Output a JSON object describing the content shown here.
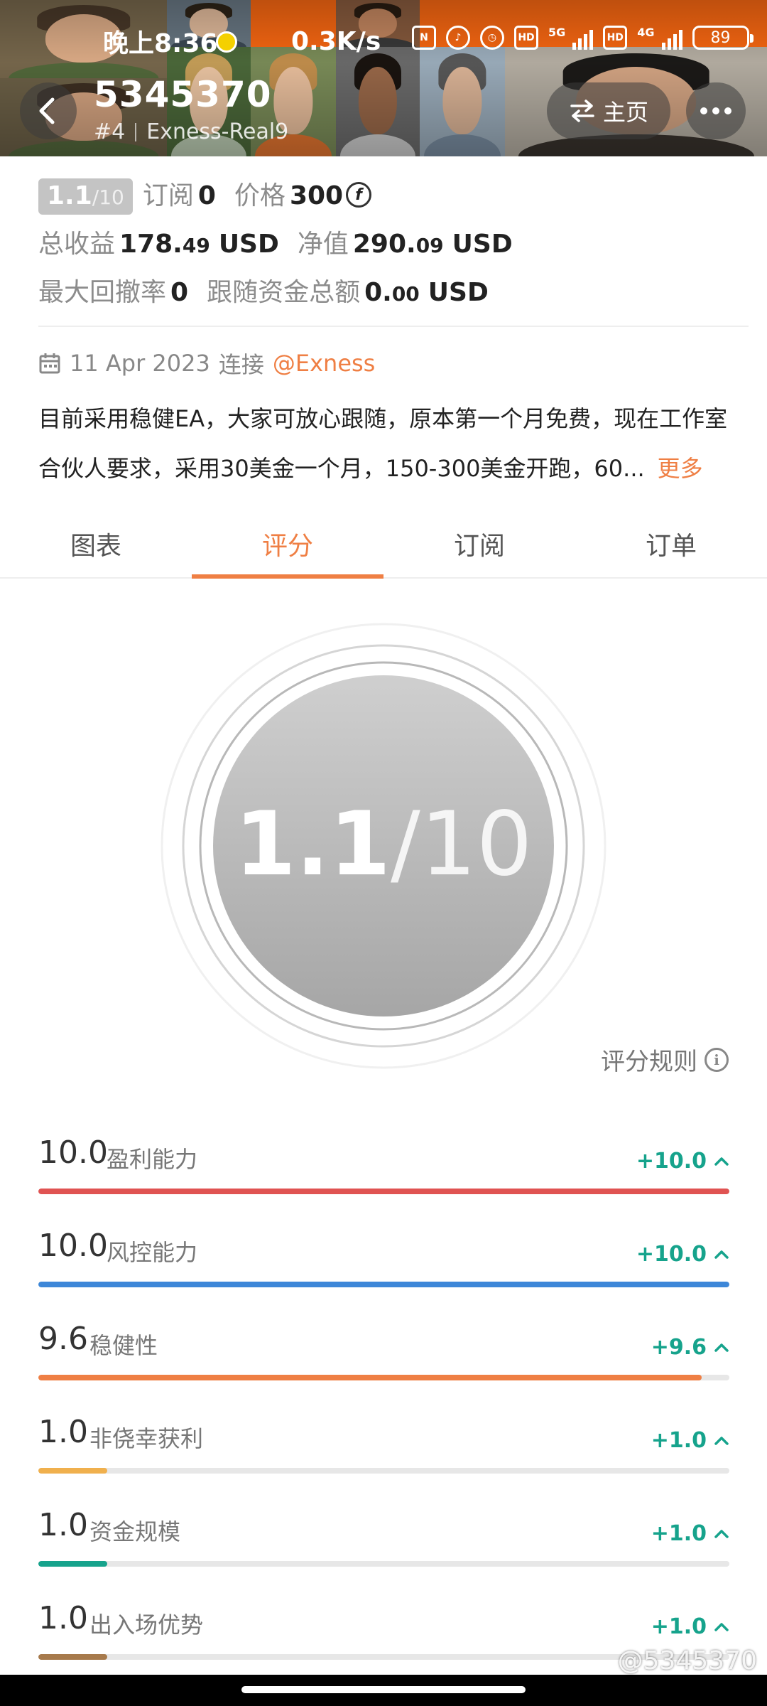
{
  "status_bar": {
    "time": "晚上8:36",
    "net_speed": "0.3K/s",
    "network_1": "5G",
    "network_2": "4G",
    "hd": "HD",
    "battery": "89"
  },
  "header": {
    "title": "5345370",
    "rank": "#4",
    "account": "Exness-Real9",
    "home_label": "主页"
  },
  "stats": {
    "score_value": "1.1",
    "score_max": "/10",
    "subscribe_label": "订阅",
    "subscribe_value": "0",
    "price_label": "价格",
    "price_value": "300",
    "coin_glyph": "f",
    "total_profit_label": "总收益",
    "total_profit_int": "178.",
    "total_profit_dec": "49",
    "total_profit_unit": "USD",
    "equity_label": "净值",
    "equity_int": "290.",
    "equity_dec": "09",
    "equity_unit": "USD",
    "drawdown_label": "最大回撤率",
    "drawdown_value": "0",
    "follow_funds_label": "跟随资金总额",
    "follow_funds_int": "0.",
    "follow_funds_dec": "00",
    "follow_funds_unit": "USD"
  },
  "info": {
    "date": "11 Apr 2023",
    "connect_label": "连接",
    "broker": "@Exness",
    "description_line1": "目前采用稳健EA，大家可放心跟随，原本第一个月免费，现在工作室",
    "description_line2": "合伙人要求，采用30美金一个月，150-300美金开跑，60...",
    "more_label": "更多"
  },
  "tabs": [
    {
      "label": "图表",
      "active": false
    },
    {
      "label": "评分",
      "active": true
    },
    {
      "label": "订阅",
      "active": false
    },
    {
      "label": "订单",
      "active": false
    }
  ],
  "score_circle": {
    "value": "1.1",
    "max": "/10"
  },
  "rules_label": "评分规则",
  "metrics": [
    {
      "score": "10.0",
      "label": "盈利能力",
      "delta": "+10.0",
      "level": 1.0,
      "color": "#e05352"
    },
    {
      "score": "10.0",
      "label": "风控能力",
      "delta": "+10.0",
      "level": 1.0,
      "color": "#3d87d8"
    },
    {
      "score": "9.6",
      "label": "稳健性",
      "delta": "+9.6",
      "level": 0.96,
      "color": "#ef7f44"
    },
    {
      "score": "1.0",
      "label": "非侥幸获利",
      "delta": "+1.0",
      "level": 0.1,
      "color": "#f0b04d"
    },
    {
      "score": "1.0",
      "label": "资金规模",
      "delta": "+1.0",
      "level": 0.1,
      "color": "#16a38c"
    },
    {
      "score": "1.0",
      "label": "出入场优势",
      "delta": "+1.0",
      "level": 0.1,
      "color": "#a77a4c"
    }
  ],
  "watermark": "@5345370",
  "colors": {
    "accent": "#ef7f44",
    "positive": "#16a38c",
    "header_orange": "#e26a2c"
  }
}
